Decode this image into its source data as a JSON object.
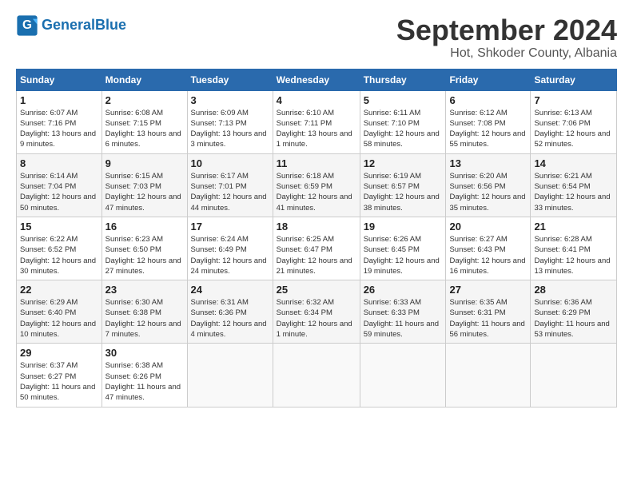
{
  "logo": {
    "text_general": "General",
    "text_blue": "Blue"
  },
  "title": "September 2024",
  "location": "Hot, Shkoder County, Albania",
  "headers": [
    "Sunday",
    "Monday",
    "Tuesday",
    "Wednesday",
    "Thursday",
    "Friday",
    "Saturday"
  ],
  "weeks": [
    [
      {
        "day": "1",
        "sunrise": "6:07 AM",
        "sunset": "7:16 PM",
        "daylight": "13 hours and 9 minutes."
      },
      {
        "day": "2",
        "sunrise": "6:08 AM",
        "sunset": "7:15 PM",
        "daylight": "13 hours and 6 minutes."
      },
      {
        "day": "3",
        "sunrise": "6:09 AM",
        "sunset": "7:13 PM",
        "daylight": "13 hours and 3 minutes."
      },
      {
        "day": "4",
        "sunrise": "6:10 AM",
        "sunset": "7:11 PM",
        "daylight": "13 hours and 1 minute."
      },
      {
        "day": "5",
        "sunrise": "6:11 AM",
        "sunset": "7:10 PM",
        "daylight": "12 hours and 58 minutes."
      },
      {
        "day": "6",
        "sunrise": "6:12 AM",
        "sunset": "7:08 PM",
        "daylight": "12 hours and 55 minutes."
      },
      {
        "day": "7",
        "sunrise": "6:13 AM",
        "sunset": "7:06 PM",
        "daylight": "12 hours and 52 minutes."
      }
    ],
    [
      {
        "day": "8",
        "sunrise": "6:14 AM",
        "sunset": "7:04 PM",
        "daylight": "12 hours and 50 minutes."
      },
      {
        "day": "9",
        "sunrise": "6:15 AM",
        "sunset": "7:03 PM",
        "daylight": "12 hours and 47 minutes."
      },
      {
        "day": "10",
        "sunrise": "6:17 AM",
        "sunset": "7:01 PM",
        "daylight": "12 hours and 44 minutes."
      },
      {
        "day": "11",
        "sunrise": "6:18 AM",
        "sunset": "6:59 PM",
        "daylight": "12 hours and 41 minutes."
      },
      {
        "day": "12",
        "sunrise": "6:19 AM",
        "sunset": "6:57 PM",
        "daylight": "12 hours and 38 minutes."
      },
      {
        "day": "13",
        "sunrise": "6:20 AM",
        "sunset": "6:56 PM",
        "daylight": "12 hours and 35 minutes."
      },
      {
        "day": "14",
        "sunrise": "6:21 AM",
        "sunset": "6:54 PM",
        "daylight": "12 hours and 33 minutes."
      }
    ],
    [
      {
        "day": "15",
        "sunrise": "6:22 AM",
        "sunset": "6:52 PM",
        "daylight": "12 hours and 30 minutes."
      },
      {
        "day": "16",
        "sunrise": "6:23 AM",
        "sunset": "6:50 PM",
        "daylight": "12 hours and 27 minutes."
      },
      {
        "day": "17",
        "sunrise": "6:24 AM",
        "sunset": "6:49 PM",
        "daylight": "12 hours and 24 minutes."
      },
      {
        "day": "18",
        "sunrise": "6:25 AM",
        "sunset": "6:47 PM",
        "daylight": "12 hours and 21 minutes."
      },
      {
        "day": "19",
        "sunrise": "6:26 AM",
        "sunset": "6:45 PM",
        "daylight": "12 hours and 19 minutes."
      },
      {
        "day": "20",
        "sunrise": "6:27 AM",
        "sunset": "6:43 PM",
        "daylight": "12 hours and 16 minutes."
      },
      {
        "day": "21",
        "sunrise": "6:28 AM",
        "sunset": "6:41 PM",
        "daylight": "12 hours and 13 minutes."
      }
    ],
    [
      {
        "day": "22",
        "sunrise": "6:29 AM",
        "sunset": "6:40 PM",
        "daylight": "12 hours and 10 minutes."
      },
      {
        "day": "23",
        "sunrise": "6:30 AM",
        "sunset": "6:38 PM",
        "daylight": "12 hours and 7 minutes."
      },
      {
        "day": "24",
        "sunrise": "6:31 AM",
        "sunset": "6:36 PM",
        "daylight": "12 hours and 4 minutes."
      },
      {
        "day": "25",
        "sunrise": "6:32 AM",
        "sunset": "6:34 PM",
        "daylight": "12 hours and 1 minute."
      },
      {
        "day": "26",
        "sunrise": "6:33 AM",
        "sunset": "6:33 PM",
        "daylight": "11 hours and 59 minutes."
      },
      {
        "day": "27",
        "sunrise": "6:35 AM",
        "sunset": "6:31 PM",
        "daylight": "11 hours and 56 minutes."
      },
      {
        "day": "28",
        "sunrise": "6:36 AM",
        "sunset": "6:29 PM",
        "daylight": "11 hours and 53 minutes."
      }
    ],
    [
      {
        "day": "29",
        "sunrise": "6:37 AM",
        "sunset": "6:27 PM",
        "daylight": "11 hours and 50 minutes."
      },
      {
        "day": "30",
        "sunrise": "6:38 AM",
        "sunset": "6:26 PM",
        "daylight": "11 hours and 47 minutes."
      },
      null,
      null,
      null,
      null,
      null
    ]
  ]
}
